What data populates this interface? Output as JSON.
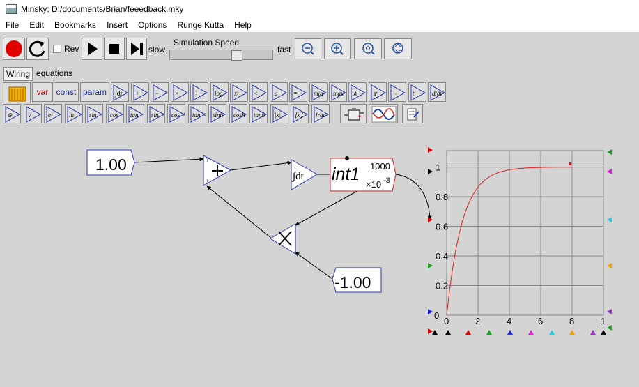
{
  "window": {
    "title": "Minsky: D:/documents/Brian/feeedback.mky"
  },
  "menu": [
    "File",
    "Edit",
    "Bookmarks",
    "Insert",
    "Options",
    "Runge Kutta",
    "Help"
  ],
  "run": {
    "rev_label": "Rev",
    "slow_label": "slow",
    "fast_label": "fast",
    "speed_label": "Simulation Speed",
    "speed_value": 0.66
  },
  "tabs": [
    "Wiring",
    "equations"
  ],
  "palette": {
    "var": "var",
    "const": "const",
    "param": "param",
    "integral": "∫dt",
    "ops1": [
      "+",
      "−",
      "×",
      "÷",
      "log",
      "xʸ",
      "<",
      "≤",
      "=",
      "min",
      "max",
      "∧",
      "∨",
      "¬",
      "t",
      "d/dt"
    ],
    "ops2": [
      "⊖",
      "√",
      "eˣ",
      "ln",
      "sin",
      "cos",
      "tan",
      "sin⁻¹",
      "cos⁻¹",
      "tan⁻¹",
      "sinh",
      "cosh",
      "tanh",
      "|x|",
      "⌊x⌋",
      "frac"
    ]
  },
  "diagram": {
    "const1": "1.00",
    "const2": "-1.00",
    "integ": "∫dt",
    "var_name": "int1",
    "var_value": "1000",
    "var_exp": "×10",
    "var_exp_power": "-3"
  },
  "plot": {
    "y_ticks": [
      "1",
      "0.8",
      "0.6",
      "0.4",
      "0.2",
      "0"
    ],
    "x_ticks": [
      "0",
      "2",
      "4",
      "6",
      "8",
      "1"
    ],
    "curve_color": "#e02020"
  }
}
